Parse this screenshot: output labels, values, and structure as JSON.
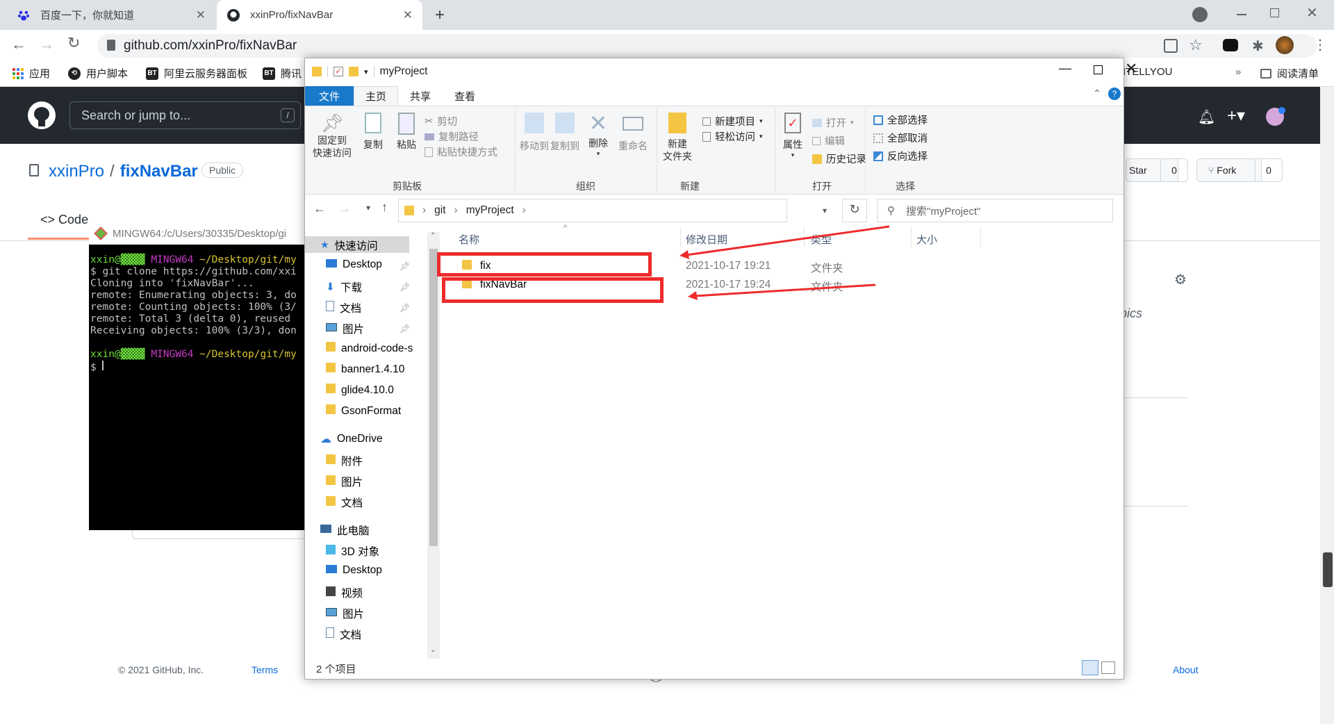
{
  "tabs": [
    {
      "title": "百度一下，你就知道"
    },
    {
      "title": "xxinPro/fixNavBar"
    }
  ],
  "address": "github.com/xxinPro/fixNavBar",
  "bookmarks": [
    {
      "label": "应用"
    },
    {
      "label": "用户脚本"
    },
    {
      "label": "阿里云服务器面板"
    },
    {
      "label": "腾讯"
    },
    {
      "label": "ITELLYOU"
    },
    {
      "label": "阅读清单"
    }
  ],
  "github": {
    "search_placeholder": "Search or jump to...",
    "slash": "/",
    "owner": "xxinPro",
    "repo": "fixNavBar",
    "visibility": "Public",
    "tab_code": "Code",
    "star": "Star",
    "star_count": "0",
    "fork": "Fork",
    "fork_count": "0",
    "footer_copy": "© 2021 GitHub, Inc.",
    "footer_terms": "Terms",
    "footer_about": "About",
    "topics_fragment": "pics"
  },
  "terminal": {
    "title": "MINGW64:/c/Users/30335/Desktop/gi",
    "user": "xxin@",
    "host": "MINGW64",
    "path": "~/Desktop/git/my",
    "lines": [
      "$ git clone https://github.com/xxi",
      "Cloning into 'fixNavBar'...",
      "remote: Enumerating objects: 3, do",
      "remote: Counting objects: 100% (3/",
      "remote: Total 3 (delta 0), reused",
      "Receiving objects: 100% (3/3), don"
    ],
    "prompt": "$ "
  },
  "explorer": {
    "title": "myProject",
    "ribbon_tabs": [
      "文件",
      "主页",
      "共享",
      "查看"
    ],
    "clipboard": {
      "pin": "固定到\n快速访问",
      "copy": "复制",
      "paste": "粘贴",
      "cut": "剪切",
      "copy_path": "复制路径",
      "paste_shortcut": "粘贴快捷方式",
      "group": "剪贴板"
    },
    "organize": {
      "move": "移动到",
      "copyto": "复制到",
      "delete": "删除",
      "rename": "重命名",
      "group": "组织"
    },
    "new": {
      "folder": "新建\n文件夹",
      "item": "新建项目",
      "easy": "轻松访问",
      "group": "新建"
    },
    "open": {
      "props": "属性",
      "open": "打开",
      "edit": "编辑",
      "history": "历史记录",
      "group": "打开"
    },
    "select": {
      "all": "全部选择",
      "none": "全部取消",
      "invert": "反向选择",
      "group": "选择"
    },
    "breadcrumb": [
      "git",
      "myProject"
    ],
    "search_placeholder": "搜索\"myProject\"",
    "nav": [
      {
        "label": "快速访问",
        "kind": "quick"
      },
      {
        "label": "Desktop",
        "kind": "desk",
        "pin": true
      },
      {
        "label": "下载",
        "kind": "dl",
        "pin": true
      },
      {
        "label": "文档",
        "kind": "doc",
        "pin": true
      },
      {
        "label": "图片",
        "kind": "pic",
        "pin": true
      },
      {
        "label": "android-code-s",
        "kind": "folder"
      },
      {
        "label": "banner1.4.10",
        "kind": "folder"
      },
      {
        "label": "glide4.10.0",
        "kind": "folder"
      },
      {
        "label": "GsonFormat",
        "kind": "folder"
      },
      {
        "label": "OneDrive",
        "kind": "cloud"
      },
      {
        "label": "附件",
        "kind": "folder"
      },
      {
        "label": "图片",
        "kind": "folder"
      },
      {
        "label": "文档",
        "kind": "folder"
      },
      {
        "label": "此电脑",
        "kind": "pc"
      },
      {
        "label": "3D 对象",
        "kind": "3d"
      },
      {
        "label": "Desktop",
        "kind": "desk"
      },
      {
        "label": "视频",
        "kind": "vid"
      },
      {
        "label": "图片",
        "kind": "pic"
      },
      {
        "label": "文档",
        "kind": "doc"
      }
    ],
    "columns": {
      "name": "名称",
      "date": "修改日期",
      "type": "类型",
      "size": "大小"
    },
    "files": [
      {
        "name": "fix",
        "date": "2021-10-17 19:21",
        "type": "文件夹"
      },
      {
        "name": "fixNavBar",
        "date": "2021-10-17 19:24",
        "type": "文件夹"
      }
    ],
    "status": "2 个项目"
  },
  "colors": {
    "ribbon_file_tab": "#1979ca",
    "annotation": "#ee2b2b",
    "github_header": "#24292f"
  }
}
